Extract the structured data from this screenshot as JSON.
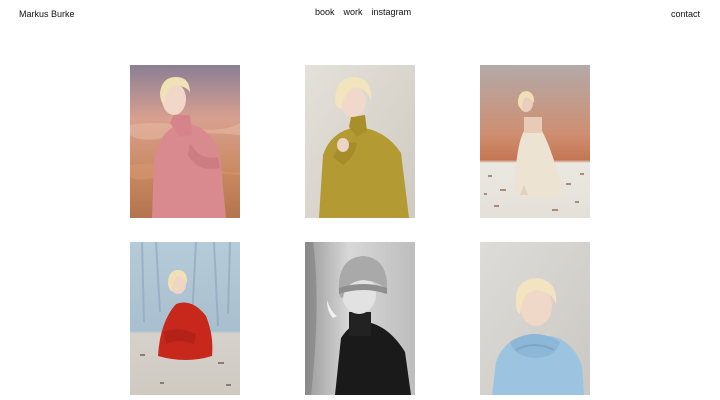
{
  "header": {
    "site_name": "Markus Burke",
    "nav": {
      "book": "book",
      "work": "work",
      "instagram": "instagram"
    },
    "contact": "contact"
  },
  "gallery": {
    "photos": [
      {
        "id": "photo-1",
        "colors": {
          "background": "#d9a58e",
          "garment": "#d98a8f"
        }
      },
      {
        "id": "photo-2",
        "colors": {
          "background": "#dcd8d0",
          "garment": "#b39a32"
        }
      },
      {
        "id": "photo-3",
        "colors": {
          "background": "#caa08e",
          "garment": "#ece3d2"
        }
      },
      {
        "id": "photo-4",
        "colors": {
          "background": "#b9cbd6",
          "garment": "#c8281c"
        }
      },
      {
        "id": "photo-5",
        "colors": {
          "background": "#c8c8c8",
          "garment": "#1a1a1a"
        }
      },
      {
        "id": "photo-6",
        "colors": {
          "background": "#d8d6d2",
          "garment": "#9cc3e0"
        }
      }
    ]
  }
}
